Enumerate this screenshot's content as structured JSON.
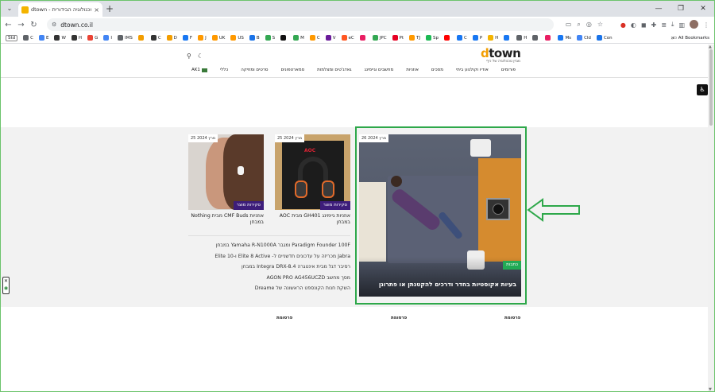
{
  "browser": {
    "tab_title": "dtown - הטכנולוגיה הבידורית",
    "tab_close": "×",
    "new_tab": "+",
    "url": "dtown.co.il",
    "bookmarks": [
      {
        "label": "Std",
        "color": "#666666"
      },
      {
        "label": "C",
        "color": "#5f6368"
      },
      {
        "label": "E",
        "color": "#4285f4"
      },
      {
        "label": "W",
        "color": "#333333"
      },
      {
        "label": "H",
        "color": "#333333"
      },
      {
        "label": "G",
        "color": "#ea4335"
      },
      {
        "label": "I",
        "color": "#4285f4"
      },
      {
        "label": "IMS",
        "color": "#5f6368"
      },
      {
        "label": "",
        "color": "#f29d00"
      },
      {
        "label": "C",
        "color": "#333333"
      },
      {
        "label": "D",
        "color": "#f29d00"
      },
      {
        "label": "F",
        "color": "#1877f2"
      },
      {
        "label": "J",
        "color": "#ff9900"
      },
      {
        "label": "UK",
        "color": "#ff9900"
      },
      {
        "label": "US",
        "color": "#ff9900"
      },
      {
        "label": "B",
        "color": "#1a73e8"
      },
      {
        "label": "S",
        "color": "#34a853"
      },
      {
        "label": "",
        "color": "#111111"
      },
      {
        "label": "M",
        "color": "#34a853"
      },
      {
        "label": "C",
        "color": "#ff9900"
      },
      {
        "label": "V",
        "color": "#6a1b9a"
      },
      {
        "label": "eC",
        "color": "#ff5722"
      },
      {
        "label": "",
        "color": "#e91e63"
      },
      {
        "label": "JPC",
        "color": "#34a853"
      },
      {
        "label": "Pt",
        "color": "#e60023"
      },
      {
        "label": "TJ",
        "color": "#ff9900"
      },
      {
        "label": "Sp",
        "color": "#1db954"
      },
      {
        "label": "",
        "color": "#ff0000"
      },
      {
        "label": "C",
        "color": "#1877f2"
      },
      {
        "label": "P",
        "color": "#1877f2"
      },
      {
        "label": "H",
        "color": "#f4b400"
      },
      {
        "label": "",
        "color": "#1877f2"
      },
      {
        "label": "H",
        "color": "#5f6368"
      },
      {
        "label": "",
        "color": "#5f6368"
      },
      {
        "label": "",
        "color": "#e91e63"
      },
      {
        "label": "Ms",
        "color": "#1877f2"
      },
      {
        "label": "Cld",
        "color": "#4285f4"
      },
      {
        "label": "Con",
        "color": "#1a73e8"
      }
    ],
    "bookmarks_more": "»",
    "all_bookmarks": "All Bookmarks"
  },
  "site": {
    "logo_d": "d",
    "logo_rest": "town",
    "logo_tagline": "מגזין טכנולוגיה של כיף",
    "nav": [
      "פורומים",
      "אודיו וקולנוע ביתי",
      "מסכים",
      "אוזניות",
      "מחשבים וגיימינג",
      "גאדג'טים ומצלמות",
      "סמארטפונים",
      "סרטים ומוזיקה",
      "כללי"
    ],
    "nav_ak1": "AK1"
  },
  "feature": {
    "date": "26 מרץ 2024",
    "category": "כתבות",
    "title": "בעיות אקוסטיות בחדר ודרכים להקטנתן או פתרונן"
  },
  "cards": [
    {
      "date": "25 מרץ 2024",
      "category": "סקירות מוצר",
      "brand": "AOC",
      "title": "אוזניות גיימינג GH401 מבית AOC במבחן"
    },
    {
      "date": "25 מרץ 2024",
      "category": "סקירות מוצר",
      "title": "אוזניות CMF Buds מבית Nothing במבחן"
    }
  ],
  "headlines": [
    "Paradigm Founder 100F ומגבר Yamaha R-N1000A במבחן",
    "Jabra מכריזה על עדכונים חדשניים ל- Elite 8 Active ו-Elite 10",
    "רסיבר דגל מבית אינטגרה Integra DRX-8.4 במבחן",
    "מסך מחשב AGON PRO AG456UCZD",
    "השקת חנות הקונספט הראשונה של Dreame"
  ],
  "ads": [
    "פרסומת",
    "פרסומת",
    "פרסומת"
  ],
  "colors": {
    "highlight": "#2ea84a",
    "feature_tag": "#22aa55",
    "card_tag": "#3d1d7a",
    "logo_accent": "#f29d00"
  }
}
